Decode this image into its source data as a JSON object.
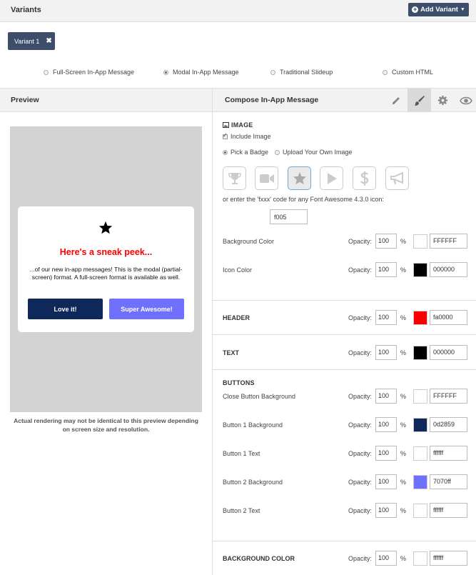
{
  "topbar": {
    "title": "Variants",
    "add_variant_label": "Add Variant"
  },
  "variant_tab": {
    "label": "Variant 1"
  },
  "message_types": [
    {
      "label": "Full-Screen In-App Message",
      "selected": false
    },
    {
      "label": "Modal In-App Message",
      "selected": true
    },
    {
      "label": "Traditional Slideup",
      "selected": false
    },
    {
      "label": "Custom HTML",
      "selected": false
    }
  ],
  "preview": {
    "title": "Preview",
    "modal": {
      "icon": "star-icon",
      "header": "Here's a sneak peek...",
      "body": "...of our new in-app messages! This is the modal (partial-screen) format. A full-screen format is available as well.",
      "button1": "Love it!",
      "button2": "Super Awesome!"
    },
    "note": "Actual rendering may not be identical to this preview depending on screen size and resolution."
  },
  "compose": {
    "title": "Compose In-App Message",
    "tools": [
      "pencil-icon",
      "paintbrush-icon",
      "gear-icon",
      "eye-icon"
    ],
    "image": {
      "title": "IMAGE",
      "include_label": "Include Image",
      "pick_badge_label": "Pick a Badge",
      "upload_label": "Upload Your Own Image",
      "badges": [
        "trophy-icon",
        "video-camera-icon",
        "star-icon",
        "play-icon",
        "dollar-icon",
        "megaphone-icon"
      ],
      "fa_hint": "or enter the 'fxxx' code for any Font Awesome 4.3.0 icon:",
      "fa_code": "f005"
    },
    "opacity_label": "Opacity:",
    "pct": "%",
    "rows": {
      "bg_color": {
        "label": "Background Color",
        "opacity": "100",
        "hex": "FFFFFF",
        "color": "#ffffff"
      },
      "icon_color": {
        "label": "Icon Color",
        "opacity": "100",
        "hex": "000000",
        "color": "#000000"
      },
      "header": {
        "label": "HEADER",
        "opacity": "100",
        "hex": "fa0000",
        "color": "#fa0000"
      },
      "text": {
        "label": "TEXT",
        "opacity": "100",
        "hex": "000000",
        "color": "#000000"
      },
      "buttons_title": "BUTTONS",
      "close_bg": {
        "label": "Close Button Background",
        "opacity": "100",
        "hex": "FFFFFF",
        "color": "#ffffff"
      },
      "btn1_bg": {
        "label": "Button 1 Background",
        "opacity": "100",
        "hex": "0d2859",
        "color": "#0d2859"
      },
      "btn1_text": {
        "label": "Button 1 Text",
        "opacity": "100",
        "hex": "ffffff",
        "color": "#ffffff"
      },
      "btn2_bg": {
        "label": "Button 2 Background",
        "opacity": "100",
        "hex": "7070ff",
        "color": "#7070ff"
      },
      "btn2_text": {
        "label": "Button 2 Text",
        "opacity": "100",
        "hex": "ffffff",
        "color": "#ffffff"
      },
      "page_bg": {
        "label": "BACKGROUND COLOR",
        "opacity": "100",
        "hex": "ffffff",
        "color": "#ffffff"
      }
    }
  }
}
